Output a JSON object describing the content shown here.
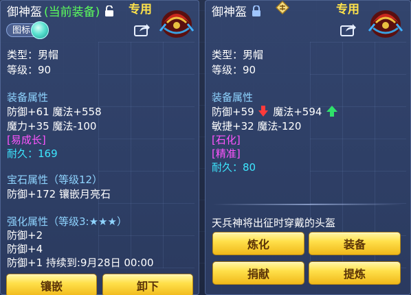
{
  "left": {
    "item_name": "御神盔",
    "equipped_tag": "(当前装备)",
    "exclusive": "专用",
    "toggle_label": "图标",
    "type_line": "类型：男帽",
    "level_line": "等级：90",
    "attr_title": "装备属性",
    "attr_line1": "防御+61 魔法+558",
    "attr_line2": "魔力+35 魔法-100",
    "special": "[易成长]",
    "durability": "耐久：169",
    "gem_title": "宝石属性（等级12）",
    "gem_line": "防御+172 镶嵌月亮石",
    "enhance_title": "强化属性（等级3:★★★）",
    "enhance_line1": "防御+2",
    "enhance_line2": "防御+4",
    "enhance_line3": "防御+1    持续到:9月28日 00:00",
    "buttons": {
      "inlay": "镶嵌",
      "unequip": "卸下"
    }
  },
  "right": {
    "item_name": "御神盔",
    "exclusive": "专用",
    "type_line": "类型：男帽",
    "level_line": "等级：90",
    "attr_title": "装备属性",
    "attr_a1": "防御+59",
    "attr_a2": "魔法+594",
    "attr_line2": "敏捷+32 魔法-120",
    "special1": "[石化]",
    "special2": "[精准]",
    "durability": "耐久：80",
    "description": "天兵神将出征时穿戴的头盔",
    "buttons": {
      "refine": "炼化",
      "equip": "装备",
      "donate": "捐献",
      "extract": "提炼"
    }
  },
  "colors": {
    "green_tag": "#5cff5c",
    "exclusive_gold": "#ffe34a",
    "cyan": "#3de7ff",
    "magenta": "#ff55ff",
    "attr_blue": "#8fd4ff"
  },
  "icons": [
    "unlock-icon",
    "lock-icon",
    "badge-icon",
    "helmet-icon",
    "share-icon",
    "arrow-down-icon",
    "arrow-up-icon"
  ]
}
